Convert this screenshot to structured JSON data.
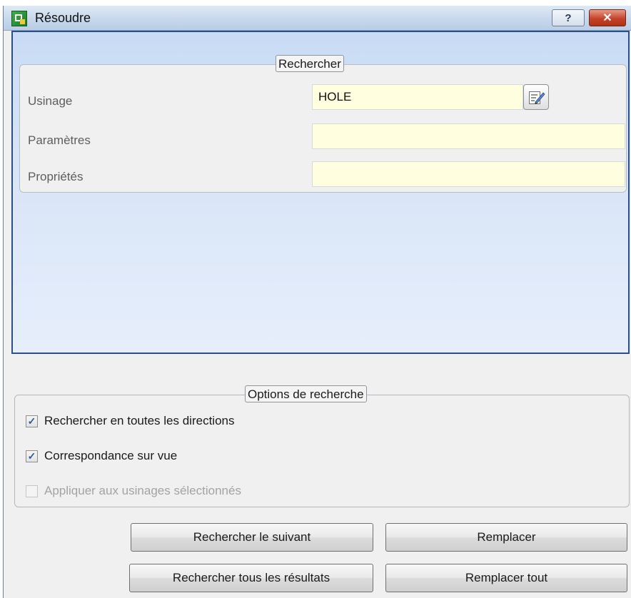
{
  "window": {
    "title": "Résoudre",
    "help_label": "?",
    "close_label": "✕"
  },
  "search": {
    "group_title": "Rechercher",
    "usinage_label": "Usinage",
    "usinage_value": "HOLE",
    "parametres_label": "Paramètres",
    "parametres_value": "",
    "proprietes_label": "Propriétés",
    "proprietes_value": ""
  },
  "options": {
    "group_title": "Options de recherche",
    "items": [
      {
        "label": "Rechercher  en toutes les directions",
        "checked": true,
        "enabled": true
      },
      {
        "label": "Correspondance sur vue",
        "checked": true,
        "enabled": true
      },
      {
        "label": "Appliquer aux usinages sélectionnés",
        "checked": false,
        "enabled": false
      }
    ]
  },
  "buttons": {
    "find_next": "Rechercher le suivant",
    "replace": "Remplacer",
    "find_all": "Rechercher tous les résultats",
    "replace_all": "Remplacer tout"
  },
  "colors": {
    "field_background": "#ffffdf",
    "panel_border": "#2b4f86",
    "check_mark": "#2f5aa7"
  },
  "icons": {
    "app": "app-icon",
    "edit": "edit-list-icon"
  }
}
